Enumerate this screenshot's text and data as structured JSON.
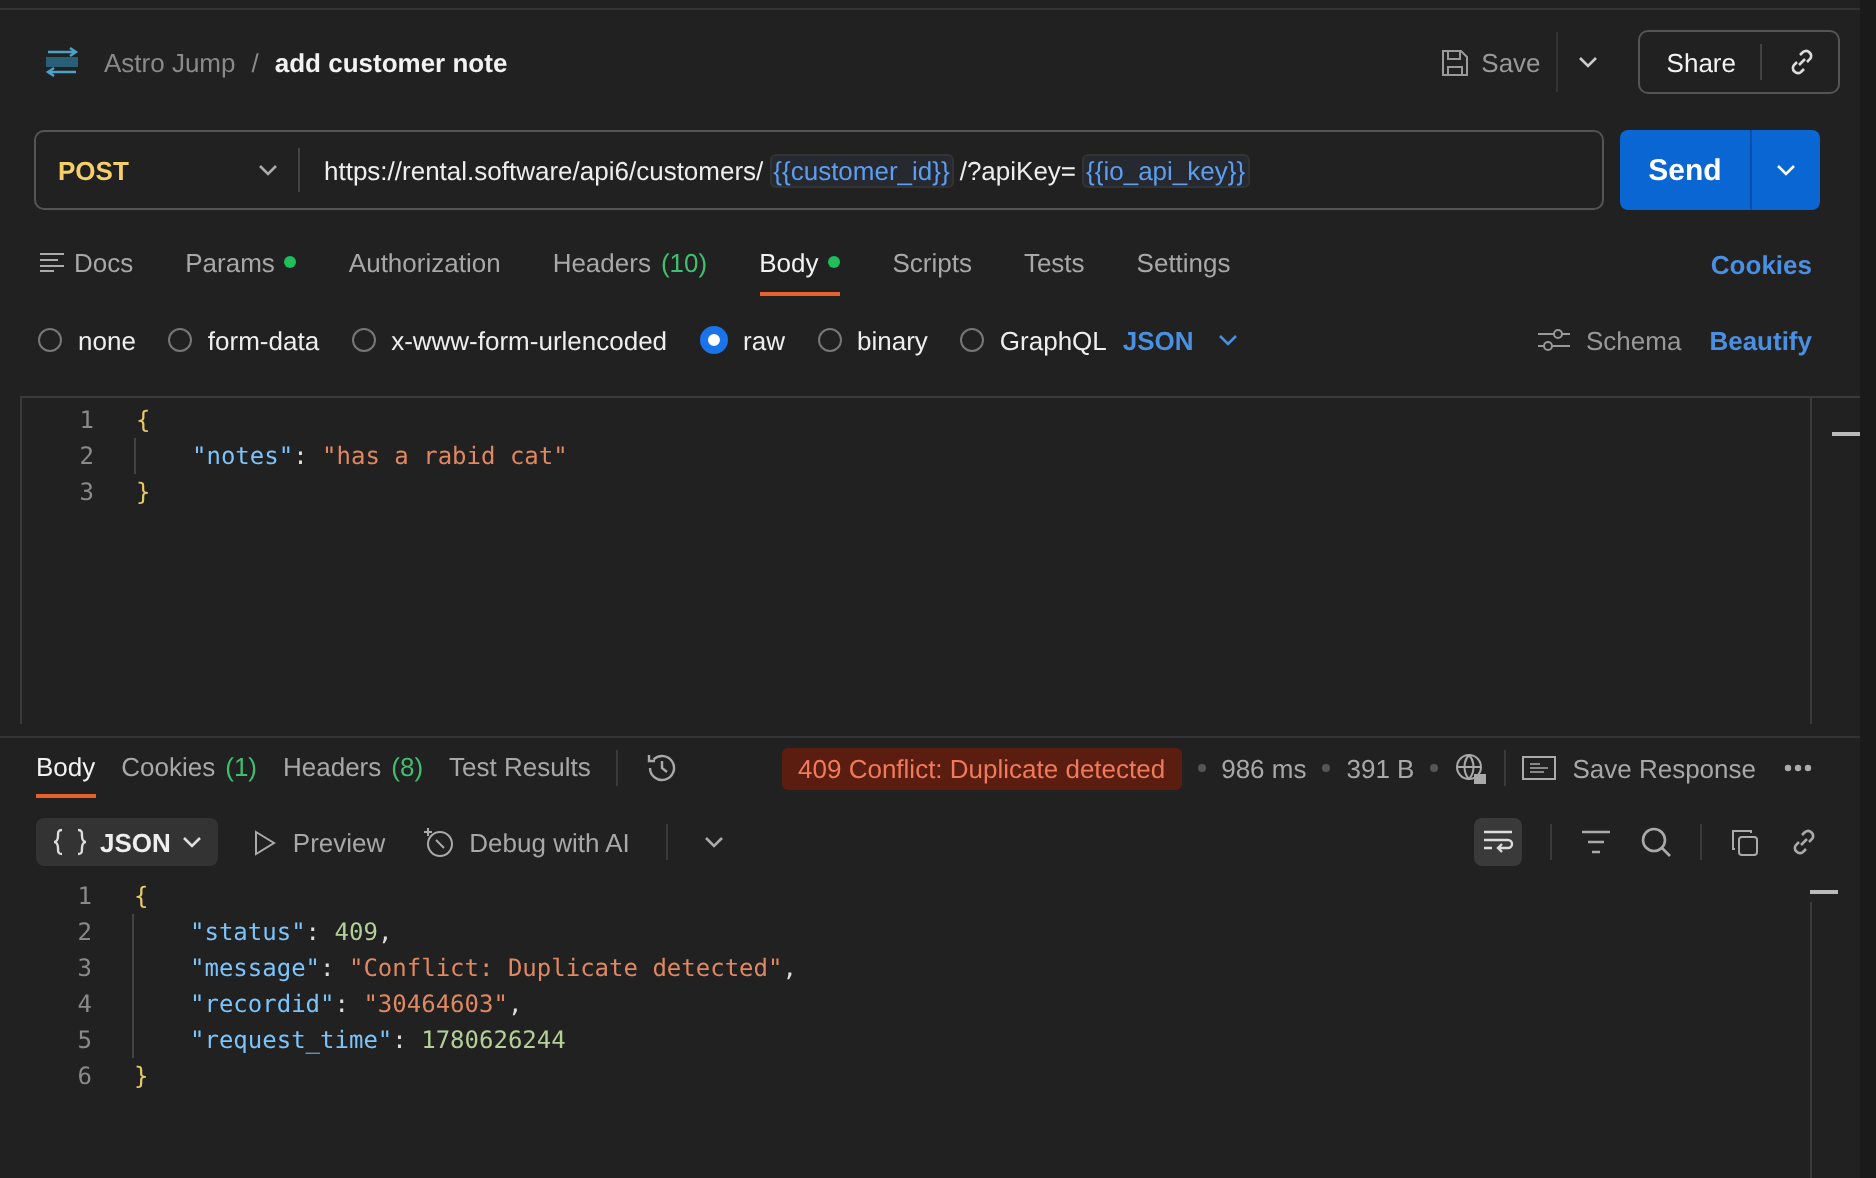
{
  "breadcrumb": {
    "collection": "Astro Jump",
    "separator": "/",
    "request": "add customer note"
  },
  "actions": {
    "save": "Save",
    "share": "Share"
  },
  "request": {
    "method": "POST",
    "url_parts": [
      {
        "kind": "text",
        "text": "https://rental.software/api6/customers/"
      },
      {
        "kind": "variable",
        "text": "{{customer_id}}"
      },
      {
        "kind": "text",
        "text": "/?apiKey="
      },
      {
        "kind": "variable",
        "text": "{{io_api_key}}"
      }
    ],
    "send": "Send"
  },
  "request_tabs": [
    {
      "label": "Docs",
      "icon": true,
      "dot": false,
      "selected": false
    },
    {
      "label": "Params",
      "dot": true,
      "selected": false
    },
    {
      "label": "Authorization",
      "dot": false,
      "selected": false
    },
    {
      "label": "Headers",
      "count": "(10)",
      "dot": false,
      "selected": false
    },
    {
      "label": "Body",
      "dot": true,
      "selected": true
    },
    {
      "label": "Scripts",
      "dot": false,
      "selected": false
    },
    {
      "label": "Tests",
      "dot": false,
      "selected": false
    },
    {
      "label": "Settings",
      "dot": false,
      "selected": false
    }
  ],
  "cookies_link": "Cookies",
  "body_types": [
    {
      "label": "none",
      "selected": false
    },
    {
      "label": "form-data",
      "selected": false
    },
    {
      "label": "x-www-form-urlencoded",
      "selected": false
    },
    {
      "label": "raw",
      "selected": true
    },
    {
      "label": "binary",
      "selected": false
    },
    {
      "label": "GraphQL",
      "selected": false
    }
  ],
  "body_format": "JSON",
  "schema": "Schema",
  "beautify": "Beautify",
  "request_body": [
    {
      "number": "1",
      "guide": false,
      "tokens": [
        {
          "kind": "punct",
          "text": "{"
        }
      ]
    },
    {
      "number": "2",
      "guide": true,
      "tokens": [
        {
          "kind": "key",
          "text": "\"notes\""
        },
        {
          "kind": "plain",
          "text": ": "
        },
        {
          "kind": "string",
          "text": "\"has a rabid cat\""
        }
      ]
    },
    {
      "number": "3",
      "guide": false,
      "tokens": [
        {
          "kind": "punct",
          "text": "}"
        }
      ]
    }
  ],
  "response_tabs": [
    {
      "label": "Body",
      "selected": true
    },
    {
      "label": "Cookies",
      "count": "(1)",
      "selected": false
    },
    {
      "label": "Headers",
      "count": "(8)",
      "selected": false
    },
    {
      "label": "Test Results",
      "selected": false
    }
  ],
  "response_meta": {
    "status": "409 Conflict: Duplicate detected",
    "time": "986 ms",
    "size": "391 B",
    "save_response": "Save Response"
  },
  "response_view": {
    "format": "JSON",
    "preview": "Preview",
    "debug": "Debug with AI"
  },
  "response_body": [
    {
      "number": "1",
      "guide": false,
      "tokens": [
        {
          "kind": "punct",
          "text": "{"
        }
      ]
    },
    {
      "number": "2",
      "guide": true,
      "tokens": [
        {
          "kind": "key",
          "text": "\"status\""
        },
        {
          "kind": "plain",
          "text": ": "
        },
        {
          "kind": "number",
          "text": "409"
        },
        {
          "kind": "plain",
          "text": ","
        }
      ]
    },
    {
      "number": "3",
      "guide": true,
      "tokens": [
        {
          "kind": "key",
          "text": "\"message\""
        },
        {
          "kind": "plain",
          "text": ": "
        },
        {
          "kind": "string",
          "text": "\"Conflict: Duplicate detected\""
        },
        {
          "kind": "plain",
          "text": ","
        }
      ]
    },
    {
      "number": "4",
      "guide": true,
      "tokens": [
        {
          "kind": "key",
          "text": "\"recordid\""
        },
        {
          "kind": "plain",
          "text": ": "
        },
        {
          "kind": "string",
          "text": "\"30464603\""
        },
        {
          "kind": "plain",
          "text": ","
        }
      ]
    },
    {
      "number": "5",
      "guide": true,
      "tokens": [
        {
          "kind": "key",
          "text": "\"request_time\""
        },
        {
          "kind": "plain",
          "text": ": "
        },
        {
          "kind": "number",
          "text": "1780626244"
        }
      ]
    },
    {
      "number": "6",
      "guide": false,
      "tokens": [
        {
          "kind": "punct",
          "text": "}"
        }
      ]
    }
  ]
}
